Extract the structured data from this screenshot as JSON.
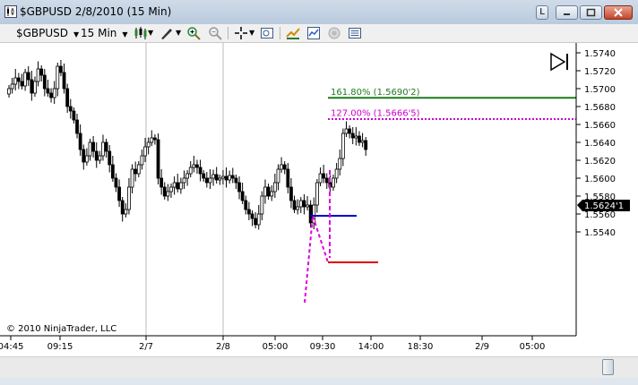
{
  "window": {
    "title": "$GBPUSD  2/8/2010 (15 Min)",
    "buttons": [
      "L",
      "minimize",
      "maximize",
      "close"
    ]
  },
  "toolbar": {
    "instrument": "$GBPUSD",
    "interval": "15 Min",
    "icons": [
      "bar-type-icon",
      "draw-tool-icon",
      "zoom-in-icon",
      "zoom-out-icon",
      "crosshair-icon",
      "properties-icon",
      "strategy-icon",
      "indicators-icon",
      "sound-icon",
      "data-box-icon"
    ]
  },
  "chart": {
    "copyright": "© 2010 NinjaTrader, LLC",
    "current_price_label": "1.5624'1",
    "y_ticks": [
      "1.5740",
      "1.5720",
      "1.5700",
      "1.5680",
      "1.5660",
      "1.5640",
      "1.5620",
      "1.5600",
      "1.5580",
      "1.5560",
      "1.5540"
    ],
    "x_ticks": [
      "04:45",
      "09:15",
      "2/7",
      "2/8",
      "05:00",
      "09:30",
      "14:00",
      "18:30",
      "2/9",
      "05:00"
    ],
    "fib_levels": [
      {
        "label": "161.80% (1.5690'2)",
        "color": "#1e7a1e"
      },
      {
        "label": "127.00% (1.5666'5)",
        "color": "#cc00cc"
      }
    ],
    "colors": {
      "up": "#ffffff",
      "down": "#000000",
      "blue_line": "#0000cc",
      "red_line": "#dd0000",
      "magenta": "#dd00dd"
    }
  },
  "chart_data": {
    "type": "candlestick",
    "title": "$GBPUSD  2/8/2010 (15 Min)",
    "ylim": [
      1.553,
      1.5745
    ],
    "x_ticks": [
      "04:45",
      "09:15",
      "2/7",
      "2/8",
      "05:00",
      "09:30",
      "14:00",
      "18:30",
      "2/9",
      "05:00"
    ],
    "last": 1.56241,
    "fib_levels": [
      1.56902,
      1.56665
    ],
    "close_series": [
      1.57,
      1.5705,
      1.5712,
      1.5708,
      1.5703,
      1.5718,
      1.571,
      1.5695,
      1.5708,
      1.5722,
      1.5715,
      1.57,
      1.5695,
      1.569,
      1.57,
      1.5725,
      1.5718,
      1.57,
      1.568,
      1.5675,
      1.5665,
      1.565,
      1.5632,
      1.5618,
      1.5625,
      1.564,
      1.563,
      1.562,
      1.5625,
      1.564,
      1.563,
      1.5615,
      1.56,
      1.559,
      1.5575,
      1.556,
      1.5565,
      1.559,
      1.561,
      1.5605,
      1.5615,
      1.5625,
      1.5635,
      1.564,
      1.5645,
      1.5643,
      1.56,
      1.559,
      1.558,
      1.5585,
      1.559,
      1.5595,
      1.5588,
      1.5595,
      1.56,
      1.5605,
      1.5612,
      1.5615,
      1.5612,
      1.5605,
      1.56,
      1.5595,
      1.56,
      1.5604,
      1.5598,
      1.56,
      1.5602,
      1.5598,
      1.5603,
      1.56,
      1.5595,
      1.5585,
      1.5575,
      1.5565,
      1.556,
      1.5555,
      1.5548,
      1.556,
      1.558,
      1.559,
      1.558,
      1.5585,
      1.5595,
      1.561,
      1.5615,
      1.561,
      1.559,
      1.5575,
      1.5565,
      1.5568,
      1.5575,
      1.5568,
      1.557,
      1.555,
      1.557,
      1.5595,
      1.5605,
      1.56,
      1.5595,
      1.559,
      1.56,
      1.561,
      1.5622,
      1.565,
      1.5655,
      1.565,
      1.5645,
      1.5647,
      1.564,
      1.5642,
      1.5632
    ]
  }
}
